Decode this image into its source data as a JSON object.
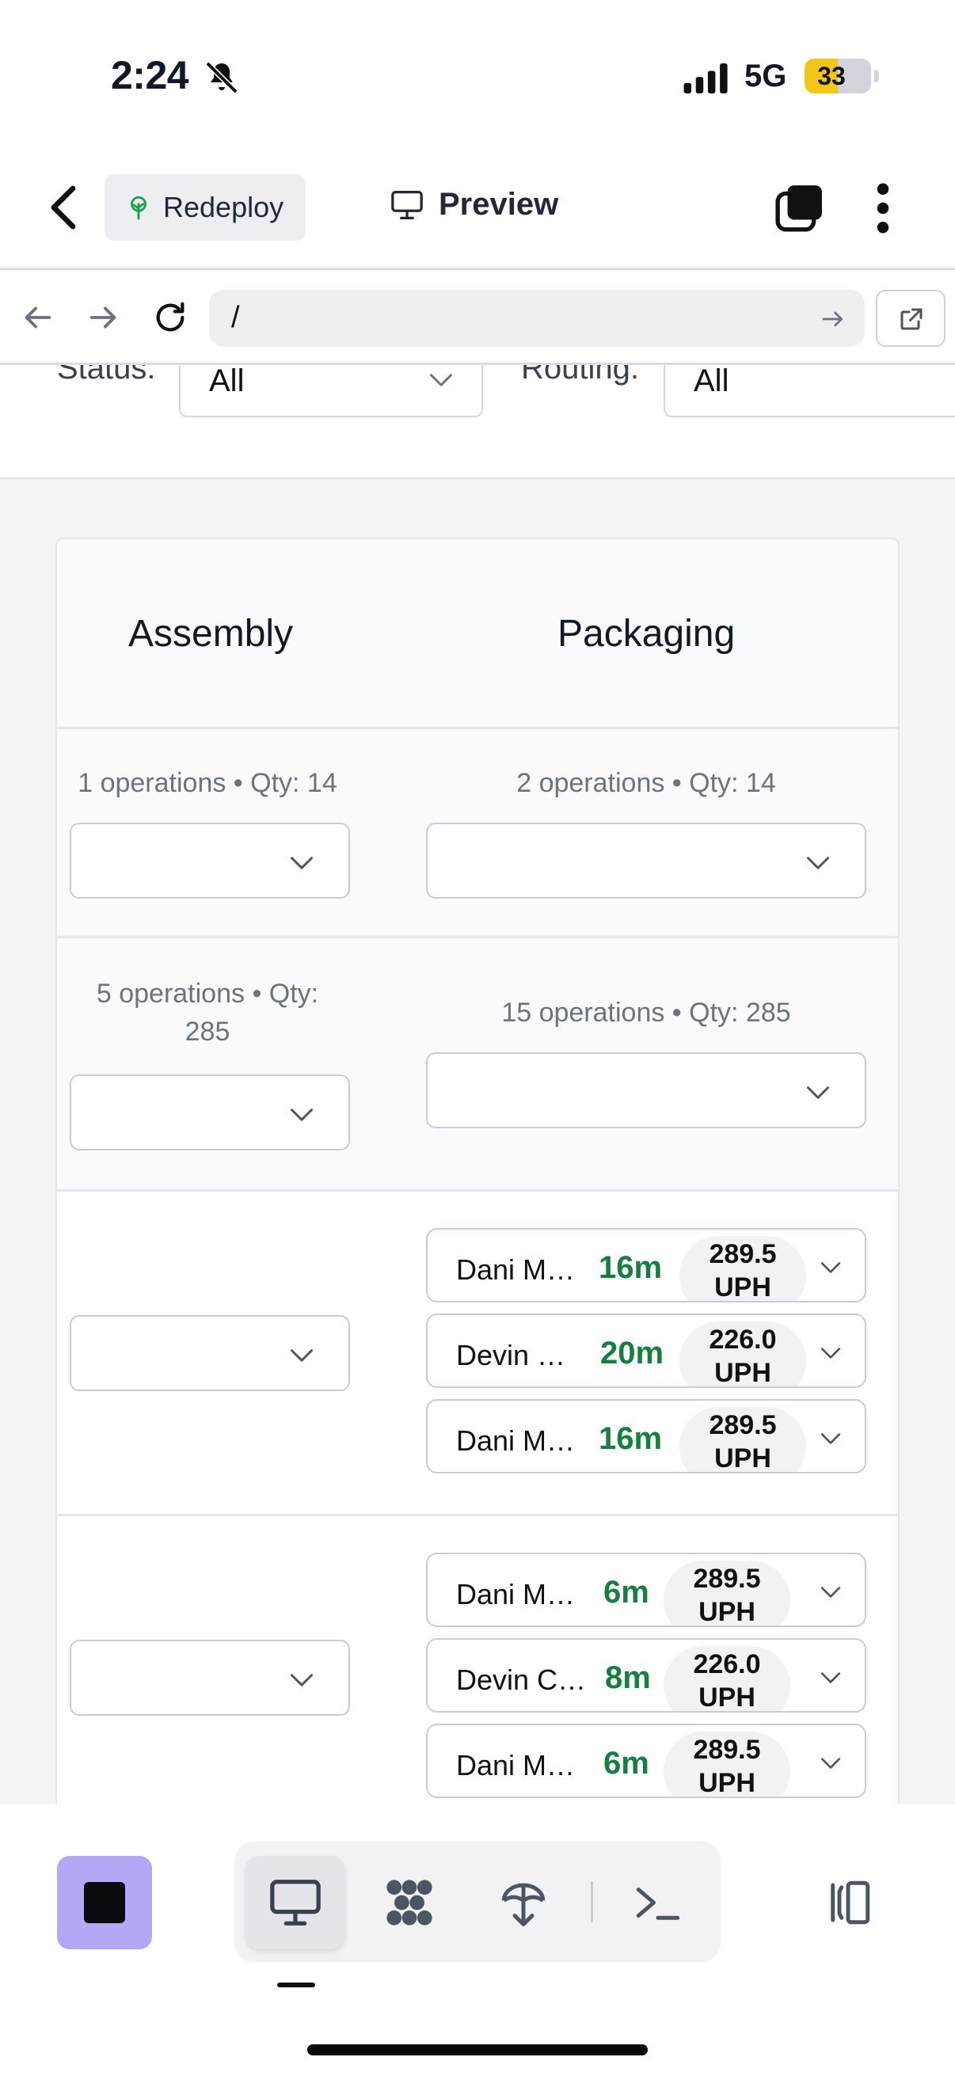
{
  "status_bar": {
    "time": "2:24",
    "network": "5G",
    "battery": "33"
  },
  "header": {
    "redeploy_label": "Redeploy",
    "preview_label": "Preview"
  },
  "browser": {
    "url": "/"
  },
  "filters": {
    "status_label": "Status:",
    "status_value": "All",
    "routing_label": "Routing:",
    "routing_value": "All"
  },
  "table": {
    "columns": [
      "Assembly",
      "Packaging"
    ],
    "rows": [
      {
        "assembly_meta": "1 operations • Qty: 14",
        "packaging_meta": "2 operations • Qty: 14"
      },
      {
        "assembly_meta": "5 operations • Qty: 285",
        "packaging_meta": "15 operations • Qty: 285"
      },
      {
        "packaging_ops": [
          {
            "name": "Dani M…",
            "duration": "16m",
            "uph": "289.5 UPH"
          },
          {
            "name": "Devin …",
            "duration": "20m",
            "uph": "226.0 UPH"
          },
          {
            "name": "Dani M…",
            "duration": "16m",
            "uph": "289.5 UPH"
          }
        ]
      },
      {
        "packaging_ops": [
          {
            "name": "Dani M…",
            "duration": "6m",
            "uph": "289.5 UPH"
          },
          {
            "name": "Devin C…",
            "duration": "8m",
            "uph": "226.0 UPH"
          },
          {
            "name": "Dani M…",
            "duration": "6m",
            "uph": "289.5 UPH"
          }
        ]
      }
    ]
  }
}
